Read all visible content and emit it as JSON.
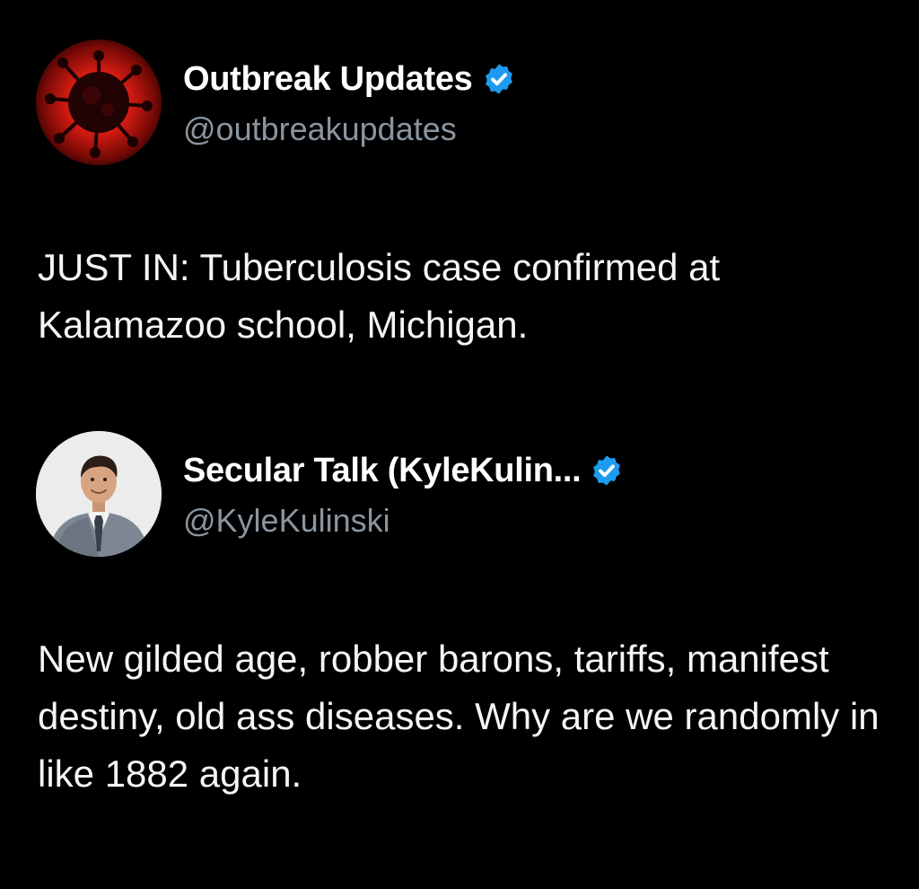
{
  "posts": [
    {
      "display_name": "Outbreak Updates",
      "handle": "@outbreakupdates",
      "verified": true,
      "avatar": "virus-avatar",
      "text": "JUST IN: Tuberculosis case confirmed at Kalamazoo school, Michigan."
    },
    {
      "display_name": "Secular Talk (KyleKulin...",
      "handle": "@KyleKulinski",
      "verified": true,
      "avatar": "man-in-suit-avatar",
      "text": "New gilded age, robber barons, tariffs, manifest destiny, old ass diseases. Why are we randomly in like 1882 again."
    }
  ],
  "colors": {
    "background": "#000000",
    "handle": "#8b959e",
    "verified_badge": "#1d9bf0",
    "text": "#f5f5f5"
  }
}
